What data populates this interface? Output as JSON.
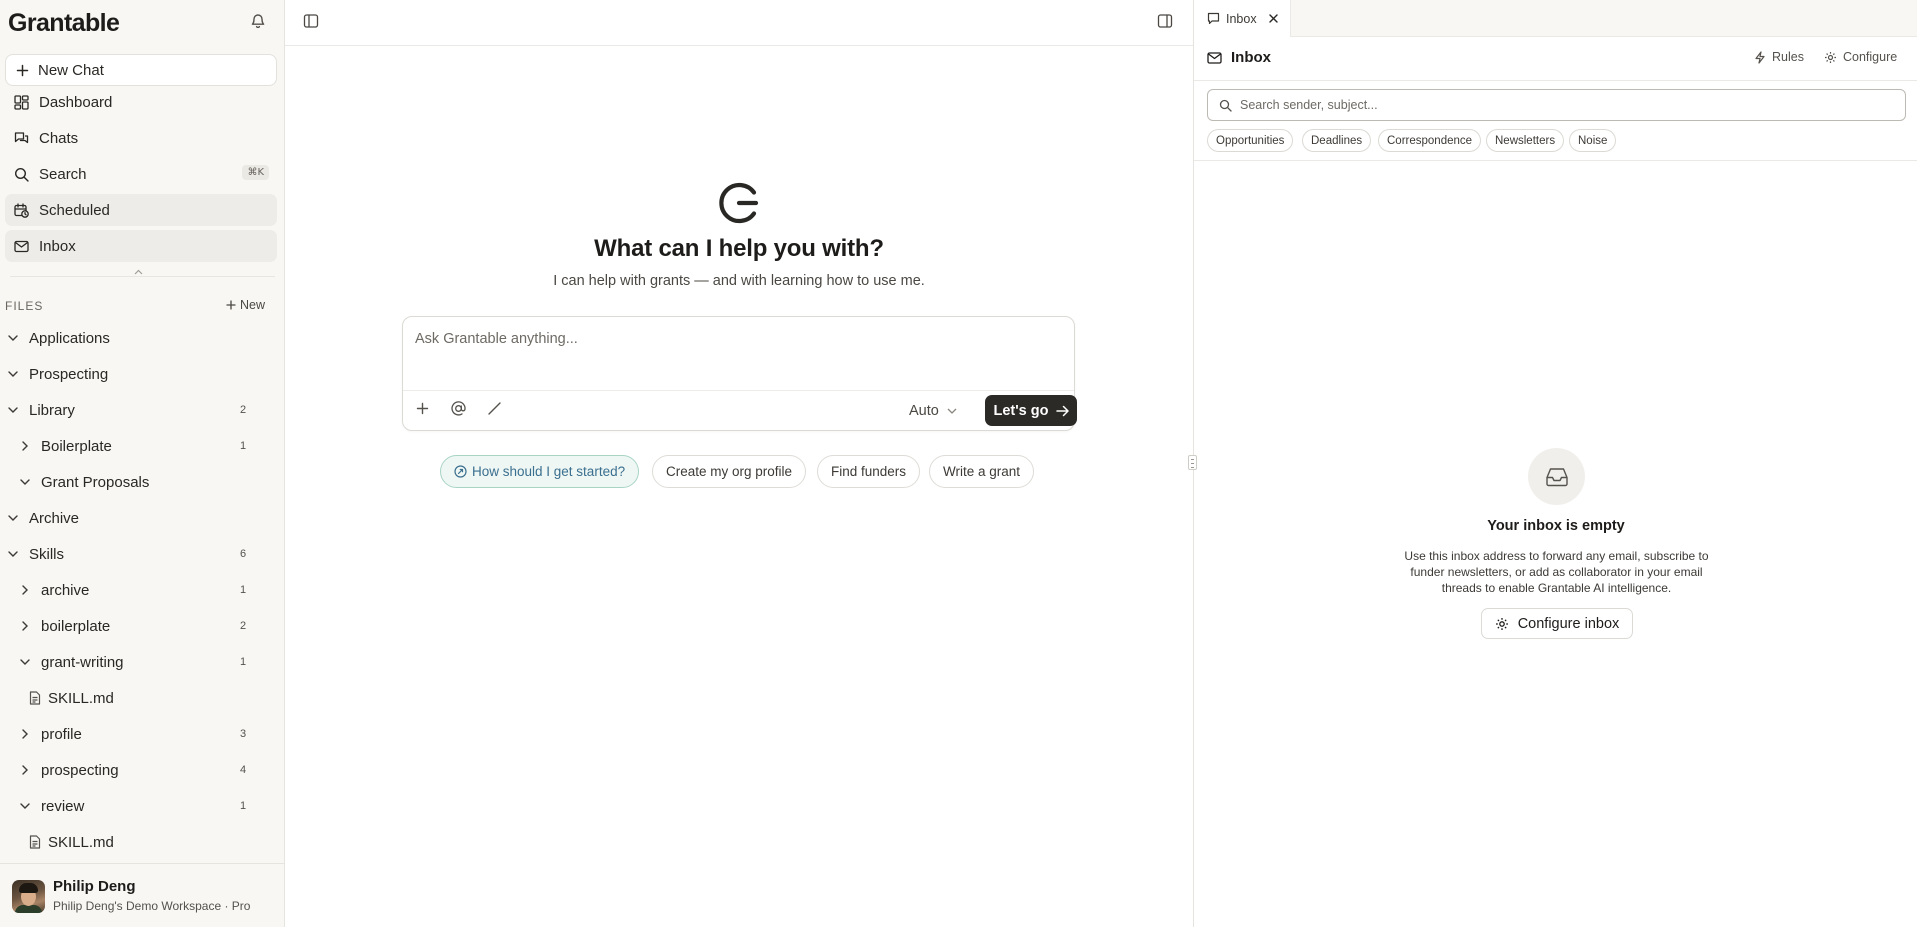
{
  "sidebar": {
    "logo": "Grantable",
    "new_chat": "New Chat",
    "nav": [
      {
        "label": "Dashboard",
        "icon": "dashboard-icon"
      },
      {
        "label": "Chats",
        "icon": "chats-icon"
      },
      {
        "label": "Search",
        "icon": "search-icon",
        "shortcut": "⌘K"
      },
      {
        "label": "Scheduled",
        "icon": "calendar-clock-icon"
      },
      {
        "label": "Inbox",
        "icon": "mail-icon"
      }
    ],
    "files_label": "FILES",
    "files_new": "New",
    "tree": [
      {
        "label": "Applications",
        "expanded": true
      },
      {
        "label": "Prospecting",
        "expanded": true
      },
      {
        "label": "Library",
        "expanded": true,
        "count": "2"
      },
      {
        "label": "Boilerplate",
        "expanded": false,
        "count": "1"
      },
      {
        "label": "Grant Proposals",
        "expanded": true
      },
      {
        "label": "Archive",
        "expanded": true
      },
      {
        "label": "Skills",
        "expanded": true,
        "count": "6"
      },
      {
        "label": "archive",
        "expanded": false,
        "count": "1"
      },
      {
        "label": "boilerplate",
        "expanded": false,
        "count": "2"
      },
      {
        "label": "grant-writing",
        "expanded": true,
        "count": "1"
      },
      {
        "label": "SKILL.md",
        "type": "file"
      },
      {
        "label": "profile",
        "expanded": false,
        "count": "3"
      },
      {
        "label": "prospecting",
        "expanded": false,
        "count": "4"
      },
      {
        "label": "review",
        "expanded": true,
        "count": "1"
      },
      {
        "label": "SKILL.md",
        "type": "file"
      }
    ],
    "user": {
      "name": "Philip Deng",
      "workspace": "Philip Deng's Demo Workspace · Pro"
    }
  },
  "main": {
    "title": "What can I help you with?",
    "subtitle": "I can help with grants — and with learning how to use me.",
    "composer": {
      "placeholder": "Ask Grantable anything...",
      "mode": "Auto",
      "submit": "Let's go"
    },
    "suggestions": [
      "How should I get started?",
      "Create my org profile",
      "Find funders",
      "Write a grant"
    ]
  },
  "inbox": {
    "tab_label": "Inbox",
    "title": "Inbox",
    "rules": "Rules",
    "configure": "Configure",
    "search_placeholder": "Search sender, subject...",
    "filters": [
      "Opportunities",
      "Deadlines",
      "Correspondence",
      "Newsletters",
      "Noise"
    ],
    "empty_title": "Your inbox is empty",
    "empty_desc": "Use this inbox address to forward any email, subscribe to funder newsletters, or add as collaborator in your email threads to enable Grantable AI intelligence.",
    "configure_button": "Configure inbox"
  },
  "colors": {
    "sidebar_bg": "#f8f7f4",
    "primary_button": "#2c2a27",
    "accent_chip_bg": "#eef7f4",
    "accent_chip_text": "#3b6f8f"
  }
}
